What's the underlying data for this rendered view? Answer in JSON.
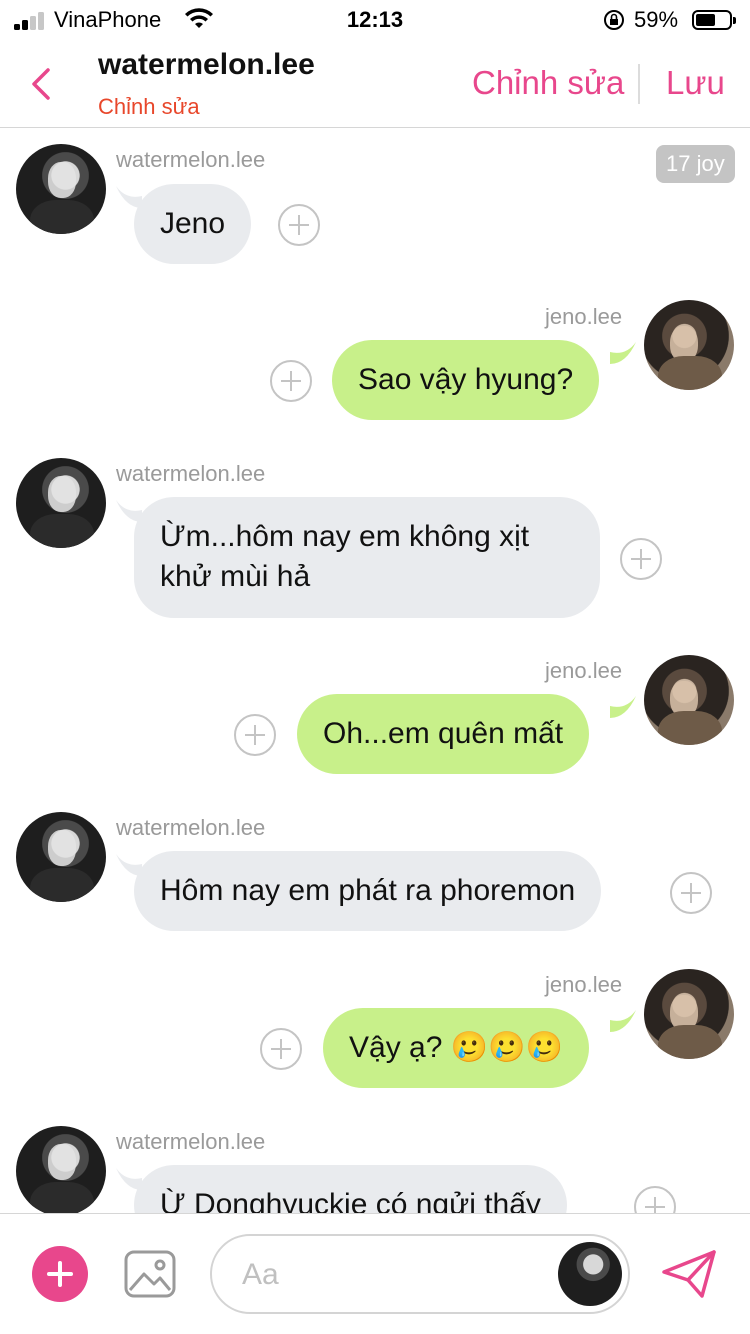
{
  "status_bar": {
    "carrier": "VinaPhone",
    "time": "12:13",
    "battery_percent": "59%",
    "battery_level": 0.59
  },
  "header": {
    "title": "watermelon.lee",
    "subtitle": "Chỉnh sửa",
    "edit_label": "Chỉnh sửa",
    "save_label": "Lưu"
  },
  "badge": "17 joy",
  "messages": [
    {
      "side": "in",
      "sender": "watermelon.lee",
      "text": "Jeno"
    },
    {
      "side": "out",
      "sender": "jeno.lee",
      "text": "Sao vậy hyung?"
    },
    {
      "side": "in",
      "sender": "watermelon.lee",
      "lines": [
        "Ừm...hôm nay em không xịt",
        "khử mùi hả"
      ]
    },
    {
      "side": "out",
      "sender": "jeno.lee",
      "text": "Oh...em quên mất"
    },
    {
      "side": "in",
      "sender": "watermelon.lee",
      "text": "Hôm nay em phát ra phoremon"
    },
    {
      "side": "out",
      "sender": "jeno.lee",
      "text": "Vậy ạ? 🥲🥲🥲"
    },
    {
      "side": "in",
      "sender": "watermelon.lee",
      "text": "Ừ Donghyuckie có ngửi thấy"
    }
  ],
  "composer": {
    "placeholder": "Aa"
  },
  "icons": {
    "back": "chevron-left-icon",
    "add": "plus-icon",
    "gallery": "image-icon",
    "send": "send-icon"
  },
  "colors": {
    "accent": "#e8478c",
    "subtitle": "#e8472b",
    "incoming_bubble": "#e9ebee",
    "outgoing_bubble": "#c8f08a"
  }
}
